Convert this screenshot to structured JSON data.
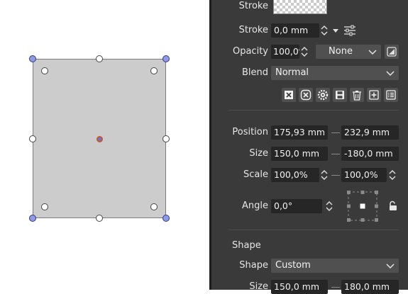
{
  "panel": {
    "stroke_label": "Stroke",
    "stroke_width_label": "Stroke",
    "stroke_width_value": "0,0 mm",
    "opacity_label": "Opacity",
    "opacity_value": "100,0%",
    "blend_fill_value": "None",
    "blend_label": "Blend",
    "blend_mode_value": "Normal",
    "icons": [
      "x-box-icon",
      "x-circle-icon",
      "gear-icon",
      "save-icon",
      "trash-icon",
      "plus-icon",
      "list-icon"
    ],
    "transform": {
      "position_label": "Position",
      "position_x": "175,93 mm",
      "position_y": "232,9 mm",
      "size_label": "Size",
      "size_w": "150,0 mm",
      "size_h": "-180,0 mm",
      "scale_label": "Scale",
      "scale_x": "100,0%",
      "scale_y": "100,0%",
      "angle_label": "Angle",
      "angle_value": "0,0°"
    },
    "shape_section": {
      "title": "Shape",
      "shape_label": "Shape",
      "shape_value": "Custom",
      "size_label": "Size",
      "size_w": "150,0 mm",
      "size_h": "180,0 mm"
    }
  },
  "colors": {
    "panel_bg": "#3a3a3a",
    "field_bg": "#262626",
    "dropdown_bg": "#505050",
    "shape_fill": "#cccccc",
    "handle_corner": "#8e9ae6"
  }
}
